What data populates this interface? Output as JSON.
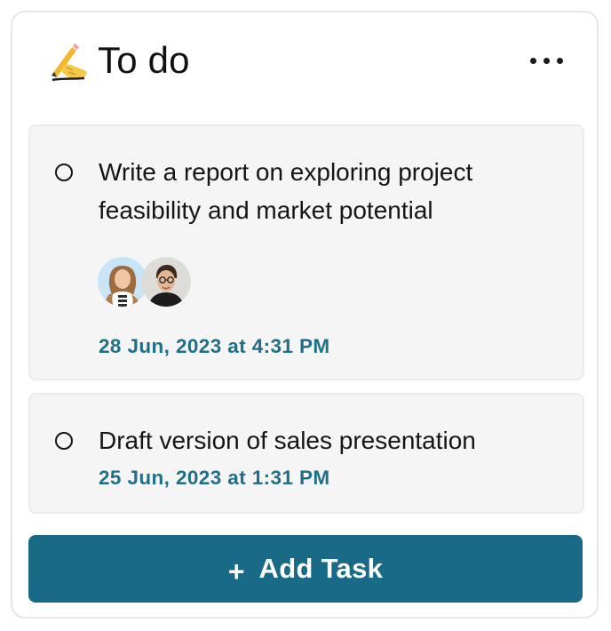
{
  "card": {
    "title": "To do",
    "title_icon": "writing-hand-icon",
    "menu_icon": "more-horizontal-icon"
  },
  "tasks": [
    {
      "title": "Write a report on exploring project feasibility and market potential",
      "date": "28 Jun, 2023 at 4:31 PM",
      "status_icon": "circle-outline-icon",
      "assignees": [
        {
          "avatar": "avatar-woman"
        },
        {
          "avatar": "avatar-man"
        }
      ]
    },
    {
      "title": "Draft version of sales presentation",
      "date": "25 Jun, 2023 at 1:31 PM",
      "status_icon": "circle-outline-icon"
    }
  ],
  "actions": {
    "add_task_label": "Add Task",
    "add_task_icon": "plus-icon"
  },
  "colors": {
    "accent": "#186a86",
    "date_text": "#1f6f88",
    "task_bg": "#f5f5f5",
    "border": "#e7e7e7"
  }
}
